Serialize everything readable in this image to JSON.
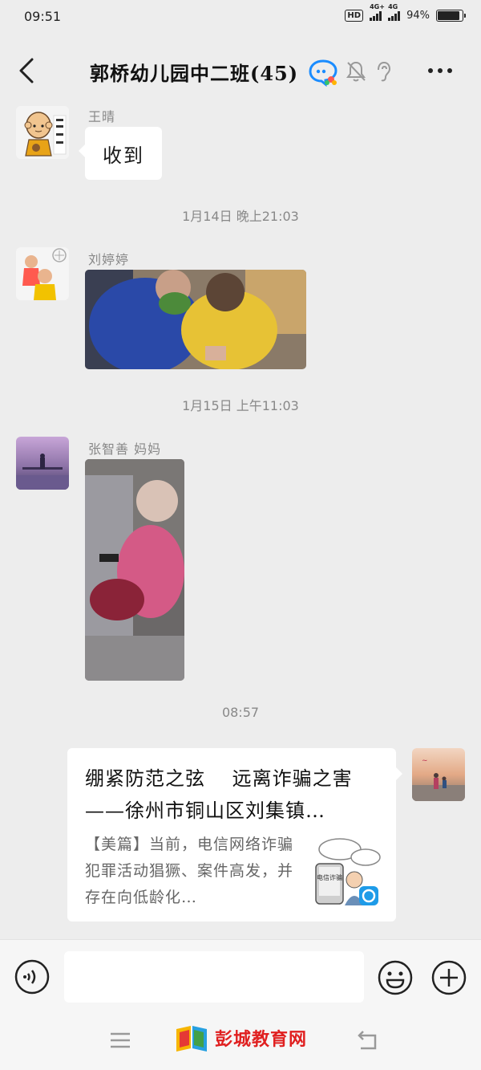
{
  "status_bar": {
    "time": "09:51",
    "network_1": "4G+",
    "network_2": "4G",
    "battery": "94%",
    "battery_level": 0.94,
    "hd_badge": "HD"
  },
  "header": {
    "title": "郭桥幼儿园中二班(45)",
    "icons": [
      "back-arrow-icon",
      "chat-bubble-icon",
      "mute-bell-icon",
      "ear-icon",
      "more-icon"
    ]
  },
  "messages": [
    {
      "sender": "王晴",
      "type": "text",
      "text": "收到"
    },
    {
      "type": "timestamp",
      "text": "1月14日 晚上21:03"
    },
    {
      "sender": "刘婷婷",
      "type": "image"
    },
    {
      "type": "timestamp",
      "text": "1月15日 上午11:03"
    },
    {
      "sender": "张智善 妈妈",
      "type": "image"
    },
    {
      "type": "timestamp",
      "text": "08:57"
    },
    {
      "sender": "me",
      "type": "link",
      "title": "绷紧防范之弦　 远离诈骗之害——徐州市铜山区刘集镇…",
      "desc": "【美篇】当前，电信网络诈骗犯罪活动猖獗、案件高发，并存在向低龄化…",
      "thumb_text": "电信诈骗"
    }
  ],
  "input": {
    "placeholder": "",
    "icons": [
      "voice-icon",
      "emoji-icon",
      "plus-icon"
    ]
  },
  "nav": {
    "watermark": "彭城教育网",
    "icons": [
      "menu-icon",
      "book-logo-icon",
      "back-nav-icon"
    ]
  },
  "colors": {
    "background": "#ededed",
    "bubble": "#ffffff",
    "accent": "#1a8cff",
    "watermark": "#e02020"
  }
}
